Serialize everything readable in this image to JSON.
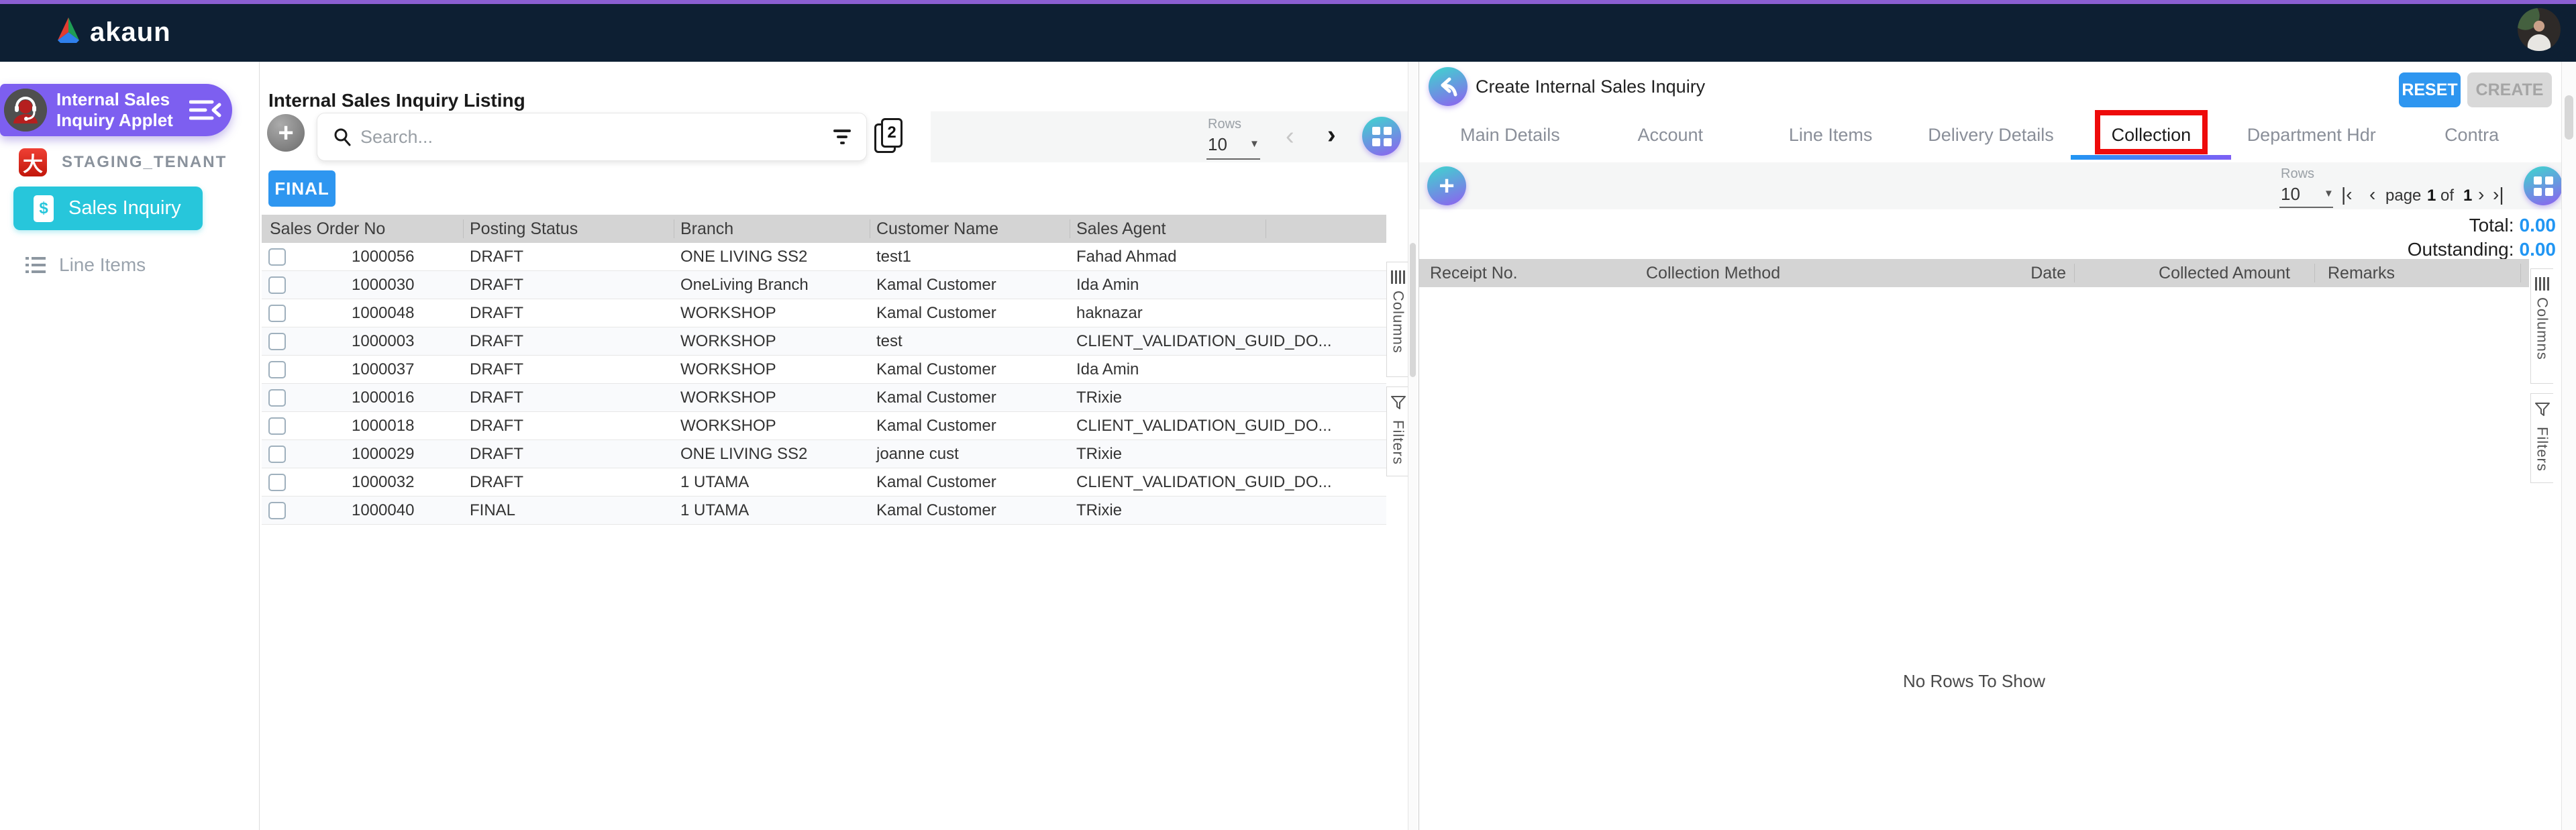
{
  "topbar": {
    "brand": "akaun"
  },
  "sidebar": {
    "applet_label": "Internal Sales Inquiry Applet",
    "tenant_label": "STAGING_TENANT",
    "items": [
      {
        "label": "Sales Inquiry",
        "active": true
      },
      {
        "label": "Line Items",
        "active": false
      }
    ]
  },
  "listing": {
    "title": "Internal Sales Inquiry Listing",
    "search": {
      "placeholder": "Search..."
    },
    "pages_badge": "2",
    "pagination": {
      "rows_label": "Rows",
      "rows_value": "10"
    },
    "final_button": "FINAL",
    "table": {
      "columns": [
        "Sales Order No",
        "Posting Status",
        "Branch",
        "Customer Name",
        "Sales Agent"
      ],
      "rows": [
        {
          "order_no": "1000056",
          "posting_status": "DRAFT",
          "branch": "ONE LIVING SS2",
          "customer_name": "test1",
          "sales_agent": "Fahad Ahmad"
        },
        {
          "order_no": "1000030",
          "posting_status": "DRAFT",
          "branch": "OneLiving Branch",
          "customer_name": "Kamal Customer",
          "sales_agent": "Ida Amin"
        },
        {
          "order_no": "1000048",
          "posting_status": "DRAFT",
          "branch": "WORKSHOP",
          "customer_name": "Kamal Customer",
          "sales_agent": "haknazar"
        },
        {
          "order_no": "1000003",
          "posting_status": "DRAFT",
          "branch": "WORKSHOP",
          "customer_name": "test",
          "sales_agent": "CLIENT_VALIDATION_GUID_DO..."
        },
        {
          "order_no": "1000037",
          "posting_status": "DRAFT",
          "branch": "WORKSHOP",
          "customer_name": "Kamal Customer",
          "sales_agent": "Ida Amin"
        },
        {
          "order_no": "1000016",
          "posting_status": "DRAFT",
          "branch": "WORKSHOP",
          "customer_name": "Kamal Customer",
          "sales_agent": "TRixie"
        },
        {
          "order_no": "1000018",
          "posting_status": "DRAFT",
          "branch": "WORKSHOP",
          "customer_name": "Kamal Customer",
          "sales_agent": "CLIENT_VALIDATION_GUID_DO..."
        },
        {
          "order_no": "1000029",
          "posting_status": "DRAFT",
          "branch": "ONE LIVING SS2",
          "customer_name": "joanne cust",
          "sales_agent": "TRixie"
        },
        {
          "order_no": "1000032",
          "posting_status": "DRAFT",
          "branch": "1 UTAMA",
          "customer_name": "Kamal Customer",
          "sales_agent": "CLIENT_VALIDATION_GUID_DO..."
        },
        {
          "order_no": "1000040",
          "posting_status": "FINAL",
          "branch": "1 UTAMA",
          "customer_name": "Kamal Customer",
          "sales_agent": "TRixie"
        }
      ]
    },
    "side_tabs": {
      "columns": "Columns",
      "filters": "Filters"
    }
  },
  "detail": {
    "title": "Create Internal Sales Inquiry",
    "reset_button": "RESET",
    "create_button": "CREATE",
    "tabs": [
      {
        "label": "Main Details"
      },
      {
        "label": "Account"
      },
      {
        "label": "Line Items"
      },
      {
        "label": "Delivery Details"
      },
      {
        "label": "Collection",
        "active": true,
        "annotated": true
      },
      {
        "label": "Department Hdr"
      },
      {
        "label": "Contra"
      }
    ],
    "pagination": {
      "rows_label": "Rows",
      "rows_value": "10",
      "page_word": "page",
      "page_current": "1",
      "of_word": "of",
      "page_total": "1"
    },
    "totals": {
      "total_label": "Total:",
      "total_value": "0.00",
      "outstanding_label": "Outstanding:",
      "outstanding_value": "0.00"
    },
    "table": {
      "columns": [
        "Receipt No.",
        "Collection Method",
        "Date",
        "Collected Amount",
        "Remarks"
      ],
      "empty_text": "No Rows To Show"
    },
    "side_tabs": {
      "columns": "Columns",
      "filters": "Filters"
    }
  },
  "icons": {
    "chevron_left": "‹",
    "chevron_right": "›",
    "page_first": "|‹",
    "page_prev": "‹",
    "page_next": "›",
    "page_last": "›|",
    "dropdown_caret": "▼",
    "plus": "+"
  },
  "colors": {
    "topbar": "#0d1f33",
    "top_strip": "#8a5fd2",
    "applet_purple": "#7d5ff0",
    "teal": "#27c6db",
    "button_blue": "#2e96f0",
    "value_blue": "#2196f3",
    "annotation_red": "#ee0b0b",
    "table_header_gray": "#d4d4d4",
    "gradient_start": "#3cd8cd",
    "gradient_end": "#8f5ff0"
  }
}
